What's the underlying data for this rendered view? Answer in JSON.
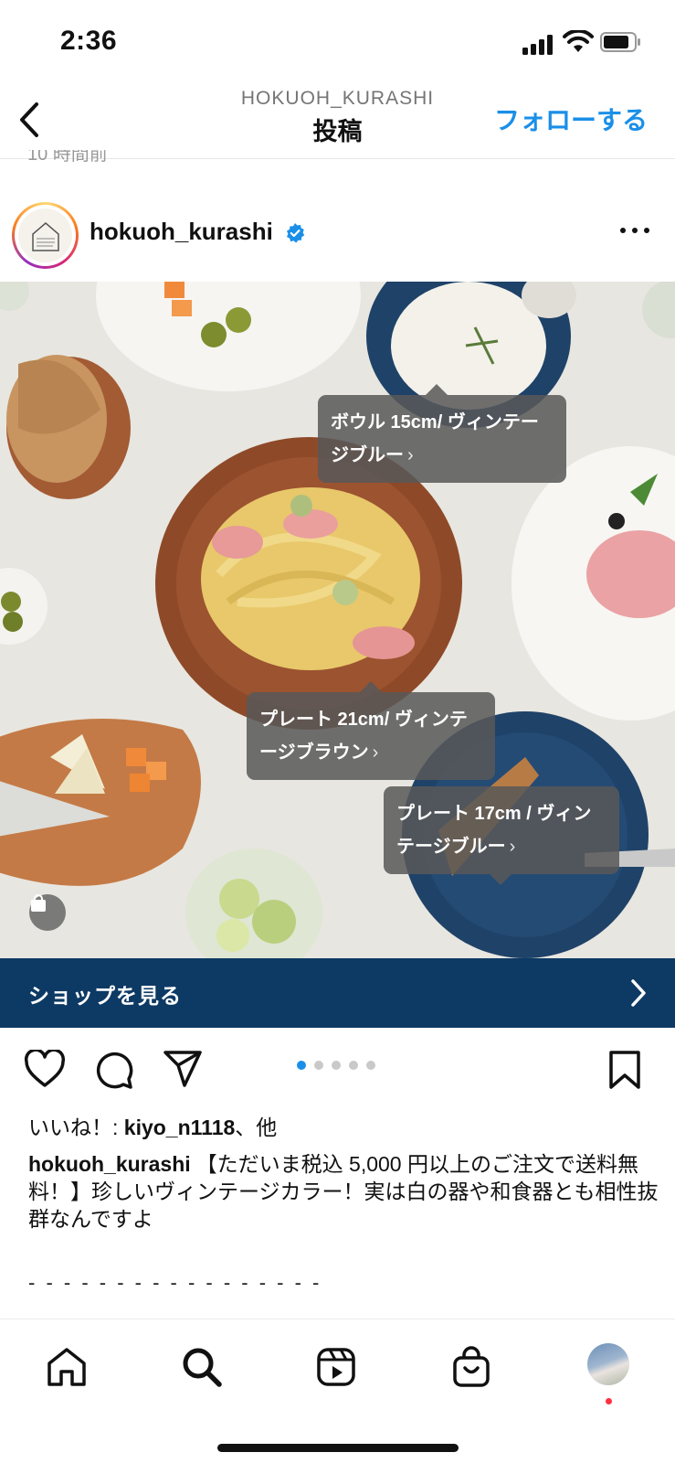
{
  "status_bar": {
    "time": "2:36"
  },
  "header": {
    "subtitle": "HOKUOH_KURASHI",
    "title": "投稿",
    "follow_label": "フォローする",
    "time_peek": "10 時間前"
  },
  "post": {
    "username": "hokuoh_kurashi",
    "verified": true,
    "tags": [
      {
        "line1": "ボウル 15cm/ ヴィンテー",
        "line2": "ジブルー"
      },
      {
        "line1": "プレート 21cm/ ヴィンテ",
        "line2": "ージブラウン"
      },
      {
        "line1": "プレート 17cm / ヴィン",
        "line2": "テージブルー"
      }
    ],
    "shop_banner": "ショップを見る",
    "carousel": {
      "total": 5,
      "active": 1
    },
    "likes_prefix": "いいね！: ",
    "likes_user": "kiyo_n1118",
    "likes_suffix": "、他",
    "caption_user": "hokuoh_kurashi",
    "caption_text": "【ただいま税込 5,000 円以上のご注文で送料無料！】珍しいヴィンテージカラー！実は白の器や和食器とも相性抜群なんですよ",
    "divider": "- - - - - - - - - - - - - - - - -"
  },
  "tab_bar": {
    "items": [
      "home-icon",
      "search-icon",
      "reels-icon",
      "shop-icon",
      "profile-avatar"
    ],
    "notification_dot": true
  },
  "colors": {
    "accent": "#1a8fe8",
    "banner": "#0d3a64",
    "notification": "#ff3040"
  }
}
